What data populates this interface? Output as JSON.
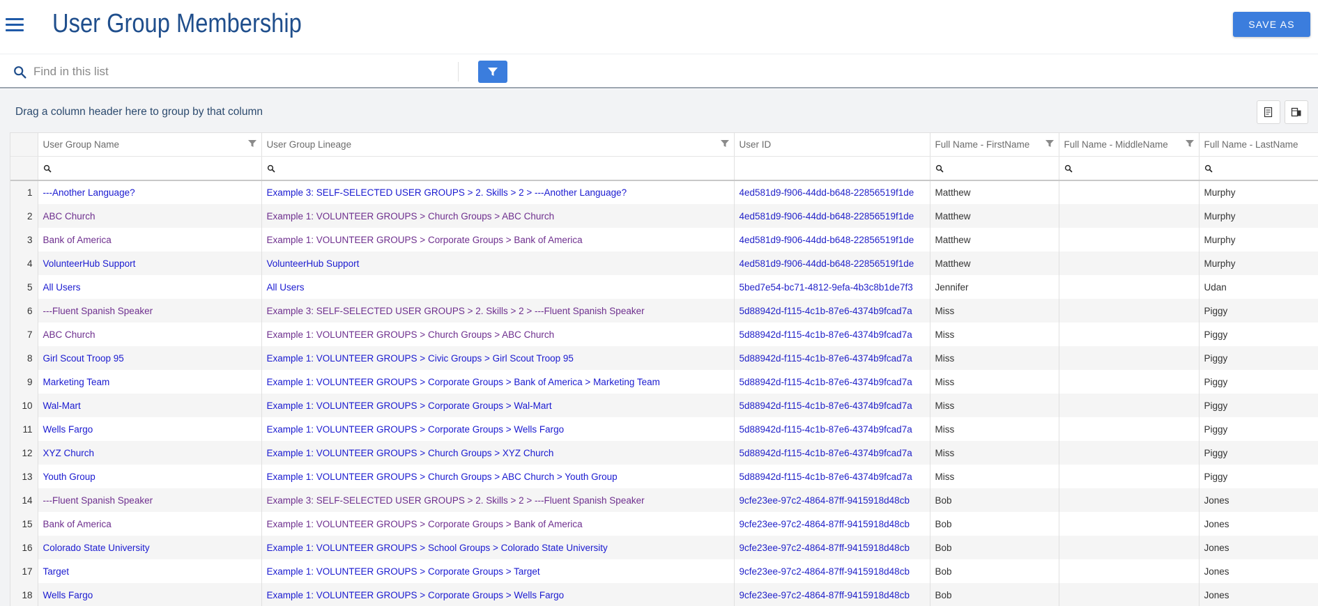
{
  "header": {
    "title": "User Group Membership",
    "save_label": "SAVE AS"
  },
  "search": {
    "placeholder": "Find in this list"
  },
  "group_panel": {
    "text": "Drag a column header here to group by that column"
  },
  "table": {
    "columns": [
      "User Group Name",
      "User Group Lineage",
      "User ID",
      "Full Name - FirstName",
      "Full Name - MiddleName",
      "Full Name - LastName"
    ],
    "rows": [
      {
        "idx": "1",
        "name": "---Another Language?",
        "lineage": "Example 3: SELF-SELECTED USER GROUPS > 2. Skills > 2 > ---Another Language?",
        "uid": "4ed581d9-f906-44dd-b648-22856519f1de",
        "first": "Matthew",
        "middle": "",
        "last": "Murphy",
        "visited": false
      },
      {
        "idx": "2",
        "name": "ABC Church",
        "lineage": "Example 1: VOLUNTEER GROUPS > Church Groups > ABC Church",
        "uid": "4ed581d9-f906-44dd-b648-22856519f1de",
        "first": "Matthew",
        "middle": "",
        "last": "Murphy",
        "visited": true
      },
      {
        "idx": "3",
        "name": "Bank of America",
        "lineage": "Example 1: VOLUNTEER GROUPS > Corporate Groups > Bank of America",
        "uid": "4ed581d9-f906-44dd-b648-22856519f1de",
        "first": "Matthew",
        "middle": "",
        "last": "Murphy",
        "visited": true
      },
      {
        "idx": "4",
        "name": "VolunteerHub Support",
        "lineage": "VolunteerHub Support",
        "uid": "4ed581d9-f906-44dd-b648-22856519f1de",
        "first": "Matthew",
        "middle": "",
        "last": "Murphy",
        "visited": false
      },
      {
        "idx": "5",
        "name": "All Users",
        "lineage": "All Users",
        "uid": "5bed7e54-bc71-4812-9efa-4b3c8b1de7f3",
        "first": "Jennifer",
        "middle": "",
        "last": "Udan",
        "visited": false
      },
      {
        "idx": "6",
        "name": "---Fluent Spanish Speaker",
        "lineage": "Example 3: SELF-SELECTED USER GROUPS > 2. Skills > 2 > ---Fluent Spanish Speaker",
        "uid": "5d88942d-f115-4c1b-87e6-4374b9fcad7a",
        "first": "Miss",
        "middle": "",
        "last": "Piggy",
        "visited": true
      },
      {
        "idx": "7",
        "name": "ABC Church",
        "lineage": "Example 1: VOLUNTEER GROUPS > Church Groups > ABC Church",
        "uid": "5d88942d-f115-4c1b-87e6-4374b9fcad7a",
        "first": "Miss",
        "middle": "",
        "last": "Piggy",
        "visited": true
      },
      {
        "idx": "8",
        "name": "Girl Scout Troop 95",
        "lineage": "Example 1: VOLUNTEER GROUPS > Civic Groups > Girl Scout Troop 95",
        "uid": "5d88942d-f115-4c1b-87e6-4374b9fcad7a",
        "first": "Miss",
        "middle": "",
        "last": "Piggy",
        "visited": false
      },
      {
        "idx": "9",
        "name": "Marketing Team",
        "lineage": "Example 1: VOLUNTEER GROUPS > Corporate Groups > Bank of America > Marketing Team",
        "uid": "5d88942d-f115-4c1b-87e6-4374b9fcad7a",
        "first": "Miss",
        "middle": "",
        "last": "Piggy",
        "visited": false
      },
      {
        "idx": "10",
        "name": "Wal-Mart",
        "lineage": "Example 1: VOLUNTEER GROUPS > Corporate Groups > Wal-Mart",
        "uid": "5d88942d-f115-4c1b-87e6-4374b9fcad7a",
        "first": "Miss",
        "middle": "",
        "last": "Piggy",
        "visited": false
      },
      {
        "idx": "11",
        "name": "Wells Fargo",
        "lineage": "Example 1: VOLUNTEER GROUPS > Corporate Groups > Wells Fargo",
        "uid": "5d88942d-f115-4c1b-87e6-4374b9fcad7a",
        "first": "Miss",
        "middle": "",
        "last": "Piggy",
        "visited": false
      },
      {
        "idx": "12",
        "name": "XYZ Church",
        "lineage": "Example 1: VOLUNTEER GROUPS > Church Groups > XYZ Church",
        "uid": "5d88942d-f115-4c1b-87e6-4374b9fcad7a",
        "first": "Miss",
        "middle": "",
        "last": "Piggy",
        "visited": false
      },
      {
        "idx": "13",
        "name": "Youth Group",
        "lineage": "Example 1: VOLUNTEER GROUPS > Church Groups > ABC Church > Youth Group",
        "uid": "5d88942d-f115-4c1b-87e6-4374b9fcad7a",
        "first": "Miss",
        "middle": "",
        "last": "Piggy",
        "visited": false
      },
      {
        "idx": "14",
        "name": "---Fluent Spanish Speaker",
        "lineage": "Example 3: SELF-SELECTED USER GROUPS > 2. Skills > 2 > ---Fluent Spanish Speaker",
        "uid": "9cfe23ee-97c2-4864-87ff-9415918d48cb",
        "first": "Bob",
        "middle": "",
        "last": "Jones",
        "visited": true
      },
      {
        "idx": "15",
        "name": "Bank of America",
        "lineage": "Example 1: VOLUNTEER GROUPS > Corporate Groups > Bank of America",
        "uid": "9cfe23ee-97c2-4864-87ff-9415918d48cb",
        "first": "Bob",
        "middle": "",
        "last": "Jones",
        "visited": true
      },
      {
        "idx": "16",
        "name": "Colorado State University",
        "lineage": "Example 1: VOLUNTEER GROUPS > School Groups > Colorado State University",
        "uid": "9cfe23ee-97c2-4864-87ff-9415918d48cb",
        "first": "Bob",
        "middle": "",
        "last": "Jones",
        "visited": false
      },
      {
        "idx": "17",
        "name": "Target",
        "lineage": "Example 1: VOLUNTEER GROUPS > Corporate Groups > Target",
        "uid": "9cfe23ee-97c2-4864-87ff-9415918d48cb",
        "first": "Bob",
        "middle": "",
        "last": "Jones",
        "visited": false
      },
      {
        "idx": "18",
        "name": "Wells Fargo",
        "lineage": "Example 1: VOLUNTEER GROUPS > Corporate Groups > Wells Fargo",
        "uid": "9cfe23ee-97c2-4864-87ff-9415918d48cb",
        "first": "Bob",
        "middle": "",
        "last": "Jones",
        "visited": false
      }
    ]
  },
  "colors": {
    "accent": "#3b7ddd",
    "title": "#1f4e8c",
    "link": "#1a1ad0",
    "visited_link": "#6e2f8e"
  },
  "icons": {
    "menu": "hamburger-menu-icon",
    "search": "search-icon",
    "filter": "filter-funnel-icon",
    "export": "export-document-icon",
    "columns": "column-chooser-icon"
  }
}
